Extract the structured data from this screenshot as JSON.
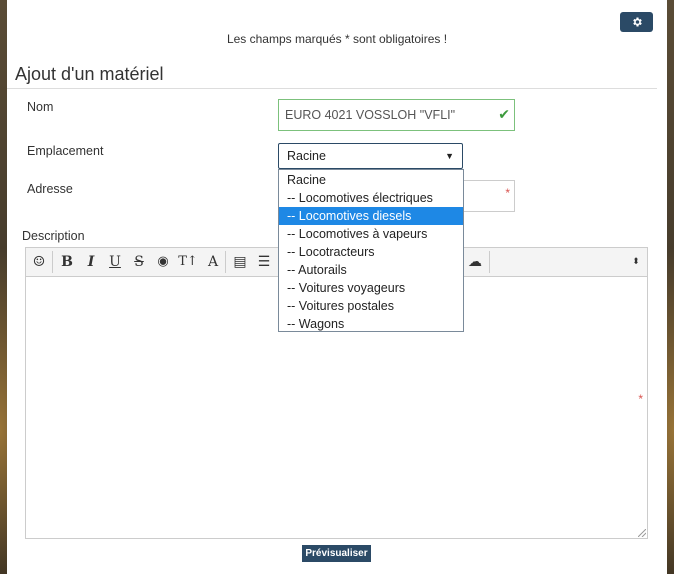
{
  "header": {
    "required_note": "Les champs marqués * sont obligatoires !",
    "settings_icon": "gear-icon"
  },
  "form": {
    "title": "Ajout d'un matériel",
    "nom": {
      "label": "Nom",
      "value": "EURO 4021 VOSSLOH \"VFLI\"",
      "valid_icon": "check-icon"
    },
    "emplacement": {
      "label": "Emplacement",
      "selected": "Racine",
      "options": [
        "Racine",
        "-- Locomotives électriques",
        "-- Locomotives diesels",
        "-- Locomotives à vapeurs",
        "-- Locotracteurs",
        "-- Autorails",
        "-- Voitures voyageurs",
        "-- Voitures postales",
        "-- Wagons"
      ],
      "highlighted_index": 2
    },
    "adresse": {
      "label": "Adresse",
      "value": ""
    },
    "description": {
      "label": "Description"
    },
    "required_marker": "*"
  },
  "toolbar": {
    "buttons": [
      {
        "name": "emoji-icon",
        "glyph": "☺"
      },
      {
        "name": "bold-icon",
        "glyph": "B"
      },
      {
        "name": "italic-icon",
        "glyph": "I"
      },
      {
        "name": "underline-icon",
        "glyph": "U"
      },
      {
        "name": "strikethrough-icon",
        "glyph": "S"
      },
      {
        "name": "color-drop-icon",
        "glyph": "💧"
      },
      {
        "name": "font-size-icon",
        "glyph": "TI"
      },
      {
        "name": "font-icon",
        "glyph": "A"
      },
      {
        "name": "paragraph-icon",
        "glyph": "▤"
      },
      {
        "name": "list-icon",
        "glyph": "☰"
      },
      {
        "name": "cloud-upload-icon",
        "glyph": "☁"
      },
      {
        "name": "chevron-updown-icon",
        "glyph": "⇕"
      }
    ]
  },
  "actions": {
    "preview_label": "Prévisualiser"
  },
  "colors": {
    "accent": "#2b4a66",
    "selected_option": "#1e88e5",
    "valid": "#3c9a3c",
    "required": "#d9534f"
  }
}
